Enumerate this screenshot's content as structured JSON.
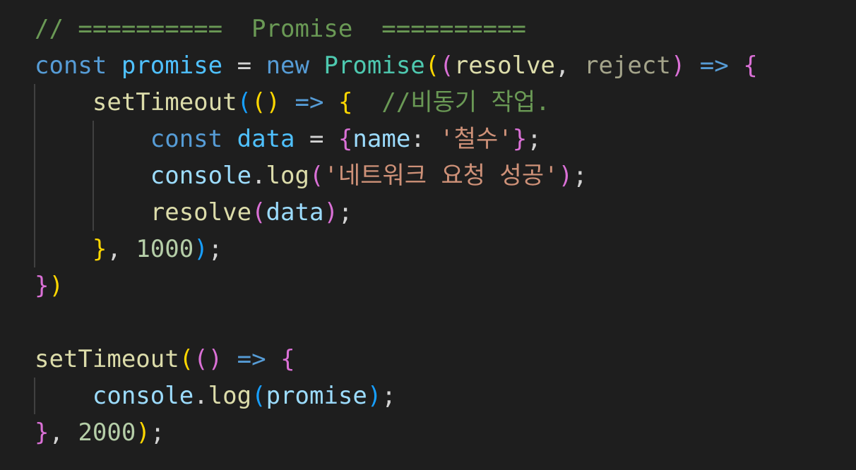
{
  "colors": {
    "background": "#1e1e1e",
    "guide": "#404040"
  },
  "code_lines": [
    [
      {
        "t": "// ==========  Promise  ==========",
        "c": "#6a9955"
      }
    ],
    [
      {
        "t": "const",
        "c": "#569cd6"
      },
      {
        "t": " ",
        "c": "#d4d4d4"
      },
      {
        "t": "promise",
        "c": "#4fc1ff"
      },
      {
        "t": " = ",
        "c": "#d4d4d4"
      },
      {
        "t": "new",
        "c": "#569cd6"
      },
      {
        "t": " ",
        "c": "#d4d4d4"
      },
      {
        "t": "Promise",
        "c": "#4ec9b0"
      },
      {
        "t": "(",
        "c": "#ffd700"
      },
      {
        "t": "(",
        "c": "#da70d6"
      },
      {
        "t": "resolve",
        "c": "#dcdcaa"
      },
      {
        "t": ", ",
        "c": "#d4d4d4"
      },
      {
        "t": "reject",
        "c": "#a4a48a"
      },
      {
        "t": ")",
        "c": "#da70d6"
      },
      {
        "t": " ",
        "c": "#d4d4d4"
      },
      {
        "t": "=>",
        "c": "#569cd6"
      },
      {
        "t": " ",
        "c": "#d4d4d4"
      },
      {
        "t": "{",
        "c": "#da70d6"
      }
    ],
    [
      {
        "t": "    ",
        "c": "#d4d4d4"
      },
      {
        "t": "setTimeout",
        "c": "#dcdcaa"
      },
      {
        "t": "(",
        "c": "#179fff"
      },
      {
        "t": "()",
        "c": "#ffd700"
      },
      {
        "t": " ",
        "c": "#d4d4d4"
      },
      {
        "t": "=>",
        "c": "#569cd6"
      },
      {
        "t": " ",
        "c": "#d4d4d4"
      },
      {
        "t": "{",
        "c": "#ffd700"
      },
      {
        "t": "  ",
        "c": "#d4d4d4"
      },
      {
        "t": "//비동기 작업.",
        "c": "#6a9955"
      }
    ],
    [
      {
        "t": "        ",
        "c": "#d4d4d4"
      },
      {
        "t": "const",
        "c": "#569cd6"
      },
      {
        "t": " ",
        "c": "#d4d4d4"
      },
      {
        "t": "data",
        "c": "#4fc1ff"
      },
      {
        "t": " = ",
        "c": "#d4d4d4"
      },
      {
        "t": "{",
        "c": "#da70d6"
      },
      {
        "t": "name",
        "c": "#9cdcfe"
      },
      {
        "t": ": ",
        "c": "#d4d4d4"
      },
      {
        "t": "'철수'",
        "c": "#ce9178"
      },
      {
        "t": "}",
        "c": "#da70d6"
      },
      {
        "t": ";",
        "c": "#d4d4d4"
      }
    ],
    [
      {
        "t": "        ",
        "c": "#d4d4d4"
      },
      {
        "t": "console",
        "c": "#9cdcfe"
      },
      {
        "t": ".",
        "c": "#d4d4d4"
      },
      {
        "t": "log",
        "c": "#dcdcaa"
      },
      {
        "t": "(",
        "c": "#da70d6"
      },
      {
        "t": "'네트워크 요청 성공'",
        "c": "#ce9178"
      },
      {
        "t": ")",
        "c": "#da70d6"
      },
      {
        "t": ";",
        "c": "#d4d4d4"
      }
    ],
    [
      {
        "t": "        ",
        "c": "#d4d4d4"
      },
      {
        "t": "resolve",
        "c": "#dcdcaa"
      },
      {
        "t": "(",
        "c": "#da70d6"
      },
      {
        "t": "data",
        "c": "#9cdcfe"
      },
      {
        "t": ")",
        "c": "#da70d6"
      },
      {
        "t": ";",
        "c": "#d4d4d4"
      }
    ],
    [
      {
        "t": "    ",
        "c": "#d4d4d4"
      },
      {
        "t": "}",
        "c": "#ffd700"
      },
      {
        "t": ", ",
        "c": "#d4d4d4"
      },
      {
        "t": "1000",
        "c": "#b5cea8"
      },
      {
        "t": ")",
        "c": "#179fff"
      },
      {
        "t": ";",
        "c": "#d4d4d4"
      }
    ],
    [
      {
        "t": "}",
        "c": "#da70d6"
      },
      {
        "t": ")",
        "c": "#ffd700"
      }
    ],
    [],
    [
      {
        "t": "setTimeout",
        "c": "#dcdcaa"
      },
      {
        "t": "(",
        "c": "#ffd700"
      },
      {
        "t": "()",
        "c": "#da70d6"
      },
      {
        "t": " ",
        "c": "#d4d4d4"
      },
      {
        "t": "=>",
        "c": "#569cd6"
      },
      {
        "t": " ",
        "c": "#d4d4d4"
      },
      {
        "t": "{",
        "c": "#da70d6"
      }
    ],
    [
      {
        "t": "    ",
        "c": "#d4d4d4"
      },
      {
        "t": "console",
        "c": "#9cdcfe"
      },
      {
        "t": ".",
        "c": "#d4d4d4"
      },
      {
        "t": "log",
        "c": "#dcdcaa"
      },
      {
        "t": "(",
        "c": "#179fff"
      },
      {
        "t": "promise",
        "c": "#9cdcfe"
      },
      {
        "t": ")",
        "c": "#179fff"
      },
      {
        "t": ";",
        "c": "#d4d4d4"
      }
    ],
    [
      {
        "t": "}",
        "c": "#da70d6"
      },
      {
        "t": ", ",
        "c": "#d4d4d4"
      },
      {
        "t": "2000",
        "c": "#b5cea8"
      },
      {
        "t": ")",
        "c": "#ffd700"
      },
      {
        "t": ";",
        "c": "#d4d4d4"
      }
    ]
  ]
}
